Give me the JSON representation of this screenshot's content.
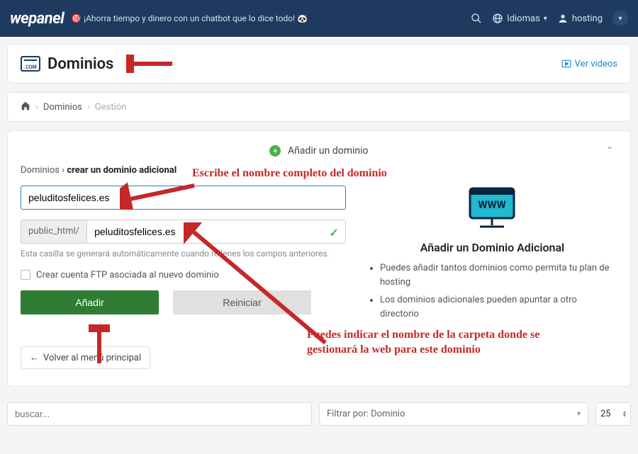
{
  "nav": {
    "brand": "wepanel",
    "tagline": "🎯 ¡Ahorra tiempo y dinero con un chatbot que lo dice todo! 🐼",
    "lang_label": "Idiomas",
    "user_label": "hosting"
  },
  "page": {
    "title": "Dominios",
    "videos": "Ver videos"
  },
  "bc": {
    "l1": "Dominios",
    "l2": "Gestión"
  },
  "section": {
    "head": "Añadir un dominio",
    "sub_a": "Dominios",
    "sub_b": "crear un dominio adicional"
  },
  "form": {
    "domain_value": "peluditosfelices.es",
    "prefix": "public_html/",
    "path_value": "peluditosfelices.es",
    "helper": "Esta casilla se generará automáticamente cuando rellenes los campos anteriores.",
    "cb_label": "Crear cuenta FTP asociada al nuevo dominio",
    "btn_add": "Añadir",
    "btn_reset": "Reiniciar",
    "back": "Volver al menú principal"
  },
  "help": {
    "title": "Añadir un Dominio Adicional",
    "li1": "Puedes añadir tantos dominios como permita tu plan de hosting",
    "li2": "Los dominios adicionales pueden apuntar a otro directorio"
  },
  "anno": {
    "a1": "Escribe el nombre completo del dominio",
    "a2": "Puedes indicar el nombre de la carpeta donde se gestionará la web para este dominio"
  },
  "footer": {
    "search_ph": "buscar...",
    "filter": "Filtrar por: Dominio",
    "pagesize": "25"
  }
}
